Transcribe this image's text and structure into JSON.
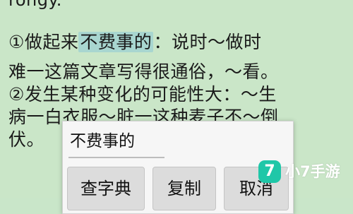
{
  "content": {
    "top_line": "rongy.",
    "line1": {
      "prefix": "①做起来",
      "highlight": "不费事的",
      "suffix": "：说时～做时"
    },
    "line2": "难一这篇文章写得很通俗，～看。",
    "line3": "②发生某种变化的可能性大：～生",
    "line4": "病一白衣服～脏一这种麦子不～倒",
    "line5": "伏。"
  },
  "popup": {
    "selected_text": "不费事的",
    "buttons": {
      "lookup": "查字典",
      "copy": "复制",
      "cancel": "取消"
    }
  },
  "watermark": {
    "badge": "7",
    "text": "小7手游"
  },
  "colors": {
    "background": "#cae6c8",
    "highlight": "#a8d6d0",
    "popup": "#f6f6f6",
    "button": "#dcdcdc",
    "watermark_badge": "#1fc7a8"
  }
}
